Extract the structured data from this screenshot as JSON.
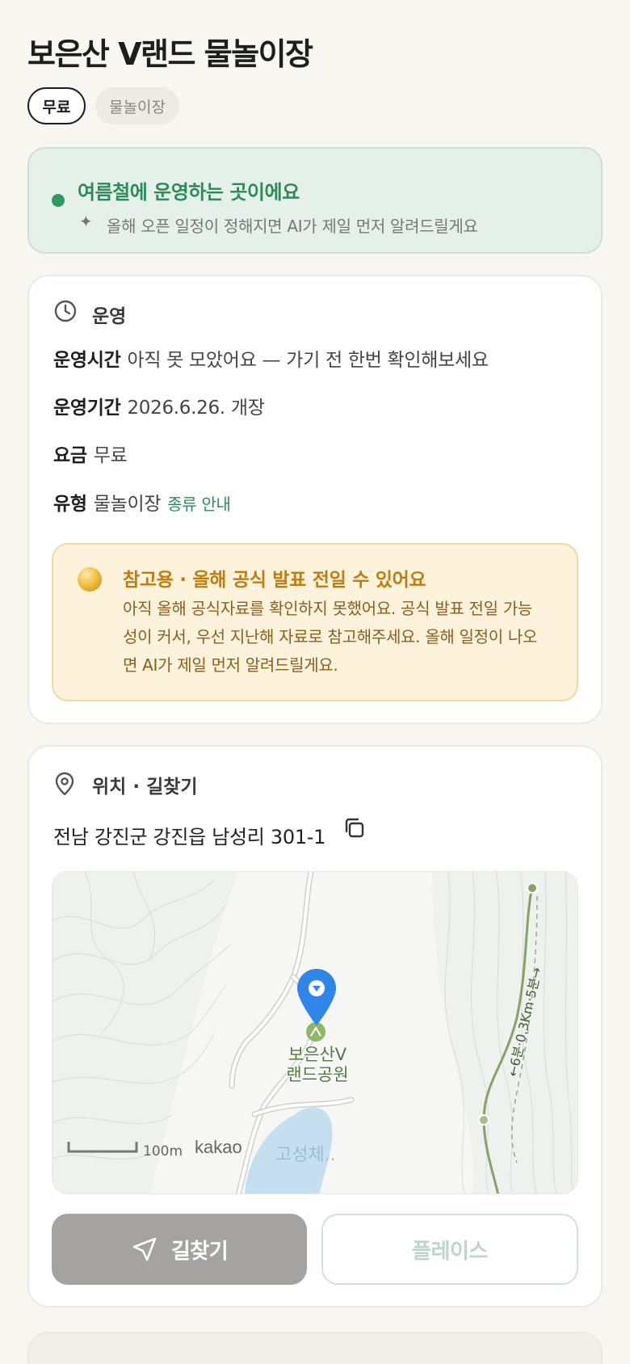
{
  "header": {
    "title": "보은산 V랜드 물놀이장",
    "chips": [
      "무료",
      "물놀이장"
    ]
  },
  "season_banner": {
    "headline": "여름철에 운영하는 곳이에요",
    "subtext": "올해 오픈 일정이 정해지면 AI가 제일 먼저 알려드릴게요",
    "icon": "sparkle-icon",
    "accent_color": "#2f9a63"
  },
  "operation": {
    "section_title": "운영",
    "icon": "clock-icon",
    "rows": [
      {
        "label": "운영시간",
        "value": "아직 못 모았어요 — 가기 전 한번 확인해보세요"
      },
      {
        "label": "운영기간",
        "value": "2026.6.26. 개장"
      },
      {
        "label": "요금",
        "value": "무료"
      },
      {
        "label": "유형",
        "value": "물놀이장",
        "link": "종류 안내"
      }
    ],
    "notice": {
      "icon": "coin-icon",
      "headline": "참고용 · 올해 공식 발표 전일 수 있어요",
      "body": "아직 올해 공식자료를 확인하지 못했어요. 공식 발표 전일 가능성이 커서, 우선 지난해 자료로 참고해주세요. 올해 일정이 나오면 AI가 제일 먼저 알려드릴게요."
    }
  },
  "location": {
    "section_title": "위치 · 길찾기",
    "icon": "location-pin-icon",
    "address": "전남 강진군 강진읍 남성리 301-1",
    "map": {
      "place_label_line1": "보은산V",
      "place_label_line2": "랜드공원",
      "trail_label": "←6분·0.3Km·5분→",
      "scale_label": "100m",
      "brand": "kakao",
      "area_label": "고성체..",
      "marker_color": "#2f86e6"
    },
    "buttons": {
      "route": "길찾기",
      "place": "플레이스"
    }
  }
}
